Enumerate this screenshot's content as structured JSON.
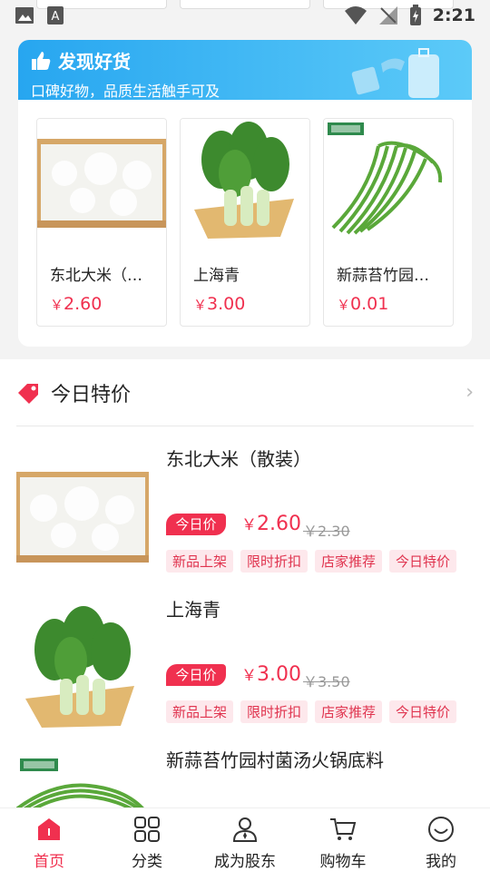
{
  "status_bar": {
    "time": "2:21",
    "icons": [
      "image-icon",
      "a-icon",
      "wifi-icon",
      "no-signal-icon",
      "battery-charging-icon"
    ]
  },
  "discover": {
    "title": "发现好货",
    "subtitle": "口碑好物，品质生活触手可及",
    "items": [
      {
        "name": "东北大米（…",
        "currency": "￥",
        "price": "2.60",
        "image": "rice"
      },
      {
        "name": "上海青",
        "currency": "￥",
        "price": "3.00",
        "image": "bok-choy"
      },
      {
        "name": "新蒜苔竹园…",
        "currency": "￥",
        "price": "0.01",
        "image": "garlic-sprouts"
      }
    ]
  },
  "special": {
    "title": "今日特价",
    "products": [
      {
        "name": "东北大米（散装）",
        "badge": "今日价",
        "currency": "￥",
        "price": "2.60",
        "old_price": "￥2.30",
        "tags": [
          "新品上架",
          "限时折扣",
          "店家推荐",
          "今日特价"
        ],
        "image": "rice"
      },
      {
        "name": "上海青",
        "badge": "今日价",
        "currency": "￥",
        "price": "3.00",
        "old_price": "￥3.50",
        "tags": [
          "新品上架",
          "限时折扣",
          "店家推荐",
          "今日特价"
        ],
        "image": "bok-choy"
      },
      {
        "name": "新蒜苔竹园村菌汤火锅底料",
        "image": "garlic-sprouts"
      }
    ]
  },
  "nav": {
    "items": [
      {
        "label": "首页",
        "icon": "home-icon",
        "active": true
      },
      {
        "label": "分类",
        "icon": "grid-icon"
      },
      {
        "label": "成为股东",
        "icon": "user-tie-icon"
      },
      {
        "label": "购物车",
        "icon": "cart-icon"
      },
      {
        "label": "我的",
        "icon": "smile-icon"
      }
    ]
  },
  "colors": {
    "accent": "#f0304f",
    "banner": "#27a6f0",
    "tag_bg": "#fde8ec"
  }
}
